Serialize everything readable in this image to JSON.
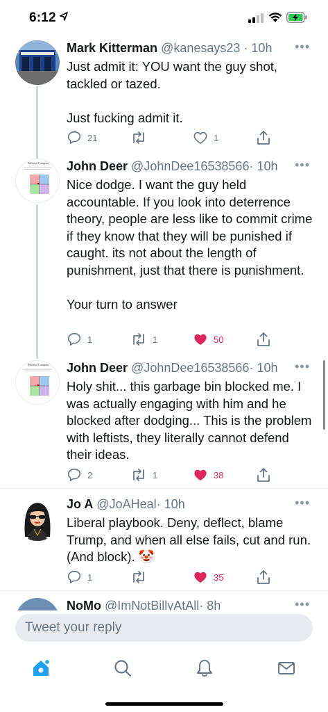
{
  "status_bar": {
    "time": "6:12"
  },
  "tweets": [
    {
      "name": "Mark Kitterman",
      "handle": "@kanesays23",
      "time": "· 10h",
      "text": "Just admit it: YOU want the guy shot, tackled or tazed.\n\nJust fucking admit it.",
      "replies": "21",
      "retweets": "",
      "likes": "1",
      "liked": false
    },
    {
      "name": "John Deer",
      "handle": "@JohnDee16538566",
      "time": "· 10h",
      "text": "Nice dodge. I want the guy held accountable. If you look into deterrence theory, people are less like to commit crime if they know that they will be punished if caught. its not about the length of punishment, just that there is punishment.\n\nYour turn to answer",
      "replies": "1",
      "retweets": "1",
      "likes": "50",
      "liked": true,
      "avatar_title": "Political Compass",
      "avatar_caption": "Economic Left/Right: -x.x\nSocial Libertarian/Authoritarian: -x.x"
    },
    {
      "name": "John Deer",
      "handle": "@JohnDee16538566",
      "time": "· 10h",
      "text": "Holy shit... this garbage bin blocked me. I was actually engaging with him and he blocked after dodging... This is the problem with leftists, they literally cannot defend their ideas.",
      "replies": "2",
      "retweets": "1",
      "likes": "38",
      "liked": true,
      "avatar_title": "Political Compass",
      "avatar_caption": "Economic Left/Right: -x.x\nSocial Libertarian/Authoritarian: -x.x"
    },
    {
      "name": "Jo A",
      "handle": "@JoAHeal",
      "time": "· 10h",
      "text": "Liberal playbook. Deny, deflect, blame Trump, and when all else fails, cut and run. (And block). 🤡",
      "replies": "1",
      "retweets": "",
      "likes": "35",
      "liked": true
    },
    {
      "name": "NoMo",
      "handle": "@ImNotBillyAtAll",
      "time": "· 8h"
    }
  ],
  "composer": {
    "placeholder": "Tweet your reply"
  },
  "tabbar": {
    "items": [
      "home-icon",
      "search-icon",
      "bell-icon",
      "mail-icon"
    ],
    "active": "home-icon",
    "accent": "#1da1f2"
  },
  "colors": {
    "like": "#e0245e",
    "secondary": "#657786",
    "accent": "#1da1f2"
  }
}
